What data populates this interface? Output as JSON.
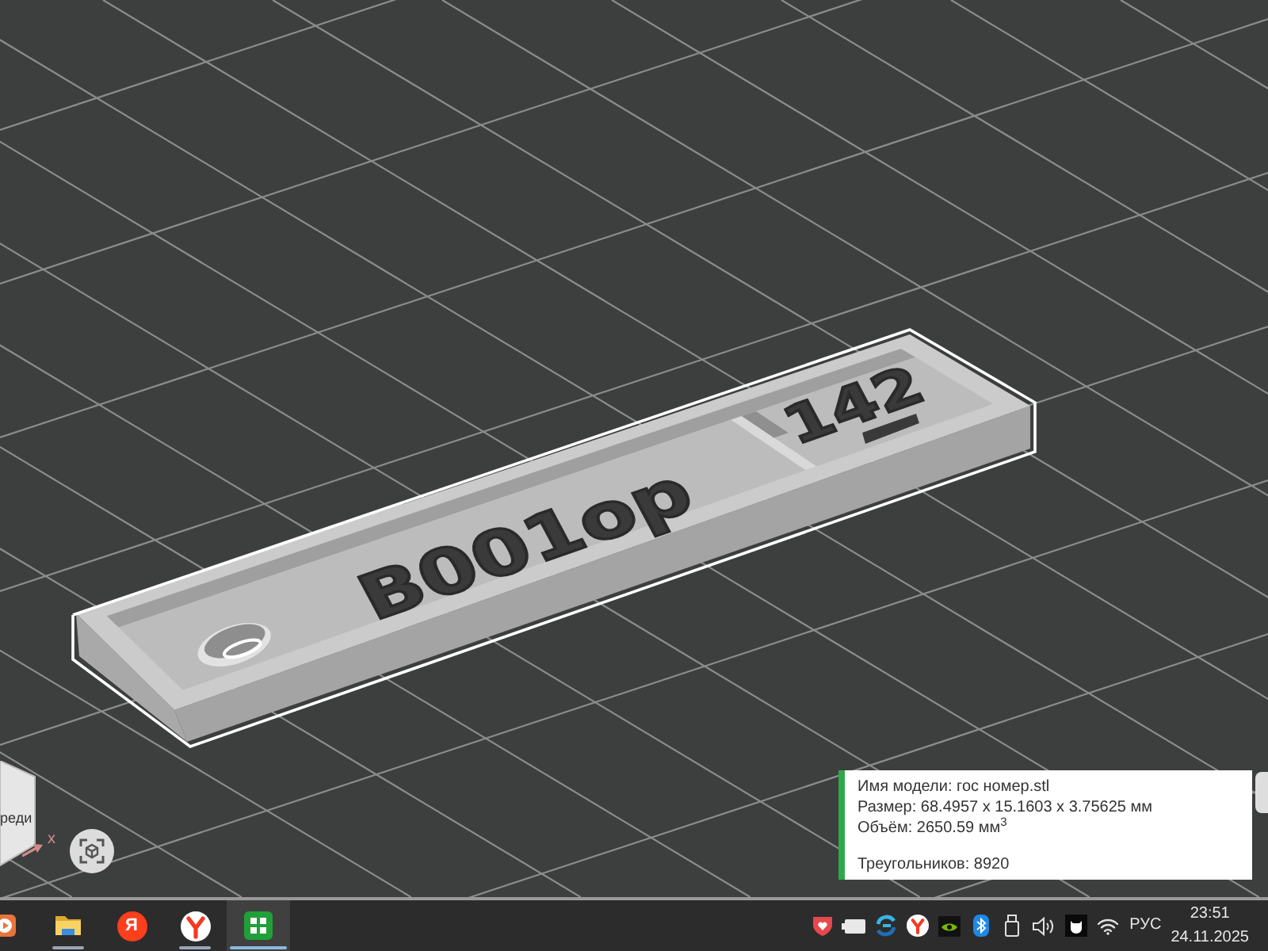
{
  "viewport": {
    "model": {
      "plate_text": "В001ор",
      "region_text": "142"
    },
    "view_cube": {
      "face_label": "реди",
      "axis_label": "x"
    },
    "info_panel": {
      "details": [
        "Имя модели: гос номер.stl",
        "Размер: 68.4957 x 15.1603 x 3.75625 мм",
        "Объём: 2650.59 мм$^{3}$"
      ],
      "triangles": "Треугольников: 8920"
    }
  },
  "taskbar": {
    "apps": [
      {
        "kind": "media",
        "running": false,
        "selected": false
      },
      {
        "kind": "folder",
        "running": true,
        "selected": false
      },
      {
        "kind": "search",
        "glyph": "Я",
        "running": false,
        "selected": false
      },
      {
        "kind": "browser",
        "running": true,
        "selected": false
      },
      {
        "kind": "grid",
        "running": true,
        "selected": true
      }
    ],
    "language": "РУС",
    "time": "23:51",
    "date": "24.11.2025"
  }
}
